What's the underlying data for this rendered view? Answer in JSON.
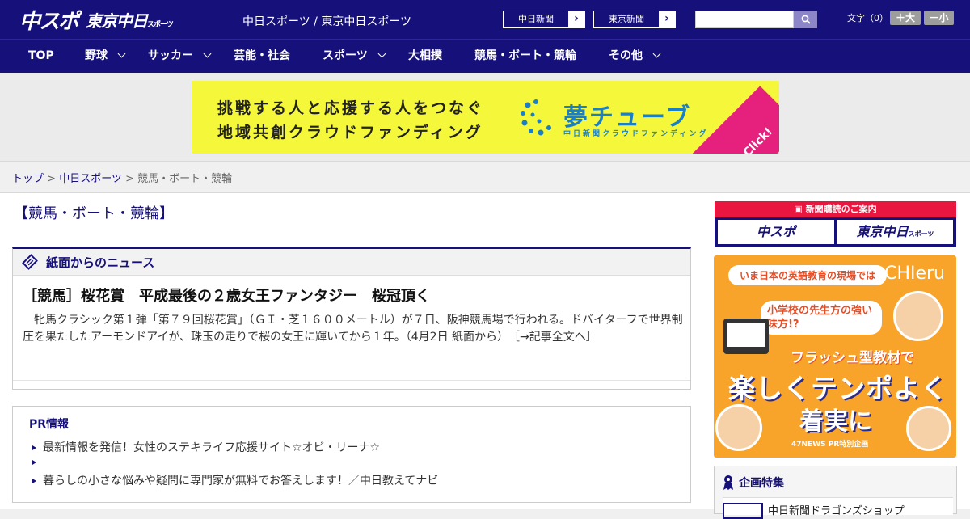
{
  "header": {
    "logo_a": "中スポ",
    "logo_b": "東京中日",
    "logo_b_suffix": "スポーツ",
    "site_title": "中日スポーツ / 東京中日スポーツ",
    "link_chunichi": "中日新聞",
    "link_tokyo": "東京新聞",
    "search_placeholder": "",
    "font_label": "文字（0）",
    "font_up": "＋大",
    "font_down": "－小"
  },
  "nav": {
    "items": [
      {
        "label": "TOP"
      },
      {
        "label": "野球"
      },
      {
        "label": "サッカー"
      },
      {
        "label": "芸能・社会"
      },
      {
        "label": "スポーツ"
      },
      {
        "label": "大相撲"
      },
      {
        "label": "競馬・ボート・競輪"
      },
      {
        "label": "その他"
      }
    ]
  },
  "banner": {
    "line1": "挑戦する人と応援する人をつなぐ",
    "line2": "地域共創クラウドファンディング",
    "logo_main": "夢チューブ",
    "logo_sub": "中日新聞クラウドファンディング",
    "click": "Click!"
  },
  "breadcrumb": {
    "home": "トップ",
    "section": "中日スポーツ",
    "current": "競馬・ボート・競輪",
    "sep": " > "
  },
  "category": {
    "title": "【競馬・ボート・競輪】"
  },
  "news": {
    "heading": "紙面からのニュース",
    "title": "［競馬］桜花賞　平成最後の２歳女王ファンタジー　桜冠頂く",
    "body": "牝馬クラシック第１弾「第７９回桜花賞」（ＧＩ・芝１６００メートル）が７日、阪神競馬場で行われる。ドバイターフで世界制圧を果たしたアーモンドアイが、珠玉の走りで桜の女王に輝いてから１年。（4月2日 紙面から）",
    "more": "［→記事全文へ］"
  },
  "pr": {
    "title": "PR情報",
    "items": [
      "最新情報を発信！女性のステキライフ応援サイト☆オビ・リーナ☆",
      "",
      "暮らしの小さな悩みや疑問に専門家が無料でお答えします！／中日教えてナビ"
    ]
  },
  "subscribe": {
    "heading": "新聞購読のご案内",
    "btn_a": "中スポ",
    "btn_b": "東京中日",
    "btn_b_suffix": "スポーツ"
  },
  "ad": {
    "top": "いま日本の英語教育の現場では",
    "brand": "CHIeru",
    "sub": "小学校の先生方の強い味方!?",
    "flash": "フラッシュ型教材で",
    "big1": "楽しくテンポよく",
    "big2": "着実に",
    "foot": "47NEWS PR特別企画"
  },
  "feature": {
    "heading": "企画特集",
    "item": "中日新聞ドラゴンズショップ"
  },
  "colors": {
    "brand": "#16107a",
    "accent_red": "#e9173f",
    "banner_yellow": "#f4f73a"
  }
}
